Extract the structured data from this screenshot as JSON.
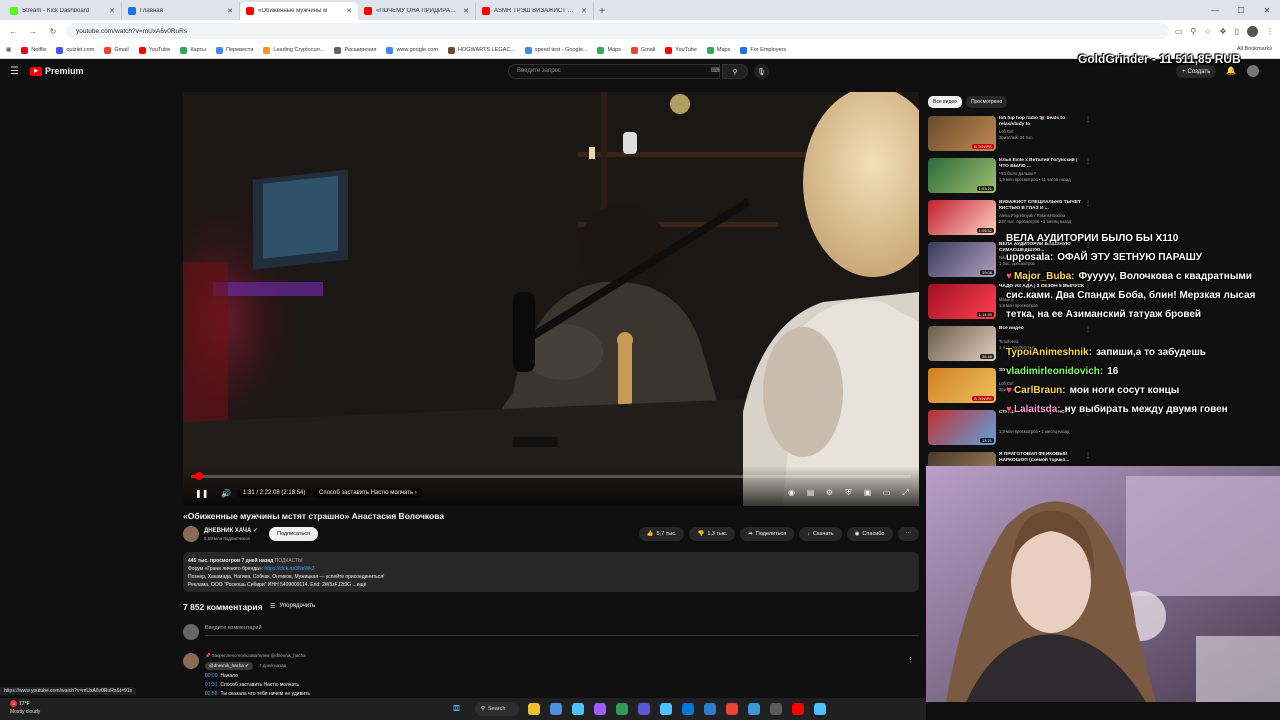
{
  "browser": {
    "tabs": [
      {
        "label": "Stream - Kick Dashboard",
        "color": "#53fc18",
        "active": false
      },
      {
        "label": "Главная",
        "color": "#1a73e8",
        "active": false
      },
      {
        "label": "«Обиженные мужчины м",
        "color": "#ff0000",
        "active": true
      },
      {
        "label": "«ПОЧЕМУ ОНА ПРИДИРАЕТС",
        "color": "#ff0000",
        "active": false
      },
      {
        "label": "ASMR ТРЭШ ВИЗАЖИСТ ДЕЛ",
        "color": "#ff0000",
        "active": false
      }
    ],
    "url": "youtube.com/watch?v=mUxA6v0RuRs",
    "bookmarks": [
      {
        "label": "Netflix",
        "color": "#e50914"
      },
      {
        "label": "quizlet.com",
        "color": "#4255ff"
      },
      {
        "label": "Gmail",
        "color": "#ea4335"
      },
      {
        "label": "YouTube",
        "color": "#ff0000"
      },
      {
        "label": "Карты",
        "color": "#34a853"
      },
      {
        "label": "Перевести",
        "color": "#4285f4"
      },
      {
        "label": "Leading Cryptocurr...",
        "color": "#f7931a"
      },
      {
        "label": "Расширения",
        "color": "#5f6368"
      },
      {
        "label": "www.google.com",
        "color": "#4285f4"
      },
      {
        "label": "HOGWARTS LEGAC...",
        "color": "#6b4a2b"
      },
      {
        "label": "speed test - Google...",
        "color": "#4285f4"
      },
      {
        "label": "Maps",
        "color": "#34a853"
      },
      {
        "label": "Gmail",
        "color": "#ea4335"
      },
      {
        "label": "YouTube",
        "color": "#ff0000"
      },
      {
        "label": "Maps",
        "color": "#34a853"
      },
      {
        "label": "For Employers",
        "color": "#1a73e8"
      }
    ],
    "all_bookmarks": "All Bookmarks",
    "status_link": "https://www.youtube.com/watch?v=mUxA6v0RuRs&t=91s"
  },
  "youtube": {
    "logo": "Premium",
    "search_placeholder": "Введите запрос",
    "create_label": "Создать",
    "player": {
      "time": "1:31 / 2:22:08 (2:18:54)",
      "chapter": "Способ заставить Настю молчать",
      "progress": 0.011
    },
    "video": {
      "title": "«Обиженные мужчины мстят страшно» Анастасия Волочкова",
      "channel": "ДНЕВНИК ХАЧА",
      "subscribers": "5,69 млн подписчиков",
      "subscribe": "Подписаться",
      "likes": "5,7 тыс.",
      "dislikes": "1,3 тыс.",
      "share": "Поделиться",
      "download": "Скачать",
      "thanks": "Спасибо"
    },
    "description": {
      "meta": "445 тыс. просмотров  7 дней назад",
      "tag": "ПОДКАСТЫ",
      "line1_pre": "Форум «Грани личного бренда»: ",
      "line1_link": "https://clck.ru/3NeWk3",
      "line2": "Познер, Хакамада, Нагиев, Собчак, Онтиков, Мужицкая — успейте присоединиться!",
      "line3": "Реклама. ООО \"Роскошь Сибири\" ИНН 5409009114. Erid: 2W5zFJ2t9G ...ещё"
    },
    "comments": {
      "count": "7 852 комментария",
      "sort": "Упорядочить",
      "input_placeholder": "Введите комментарий",
      "pinned_label": "Закреплено пользователем @dnevnik_hacha",
      "pinned_author": "@dnevnik_hacha",
      "pinned_date": "7 дней назад",
      "lines": [
        {
          "ts": "00:00",
          "text": "Начало"
        },
        {
          "ts": "01:31",
          "text": "Способ заставить Настю молчать"
        },
        {
          "ts": "02:58",
          "text": "Ты сказала что тебя ничем не удивить"
        }
      ]
    },
    "chips": [
      "Все видео",
      "Просмотрено"
    ],
    "recommendations": [
      {
        "title": "lofi hip hop radio 📚 beats to relax/study to",
        "channel": "Lofi Girl",
        "meta": "Зрителей: 24 тыс.",
        "badge": "В ЭФИРЕ",
        "colors": [
          "#6a4a2a",
          "#c08a55"
        ]
      },
      {
        "title": "Илья Exile x Виталий Гогунский | ЧТО БЫЛО ...",
        "channel": "Что было дальше?",
        "meta": "1,9 млн просмотров • 11 часов назад",
        "badge": "1:53:21",
        "colors": [
          "#2a6a3a",
          "#a0c070"
        ]
      },
      {
        "title": "ВИЗАЖИСТ СПЕЦИАЛЬНО ТЫЧЕТ КИСТЬЮ В ГЛАЗ И ...",
        "channel": "Alena Pogrebnyak / RobinsHoodina",
        "meta": "237 тыс. просмотров • 1 месяц назад",
        "badge": "1:05:52",
        "colors": [
          "#c02030",
          "#ffd0c0"
        ]
      },
      {
        "title": "ВЕЛА АУДИТОРИИ БЕШЕНУЮ СУМАСШЕДШУЮ...",
        "channel": "Nikita",
        "meta": "1 тыс. просмотров",
        "badge": "19:08",
        "colors": [
          "#3a3a5a",
          "#b0a0c0"
        ]
      },
      {
        "title": "ЧАДО ИЗ АДА | 3 СЕЗОН 5 ВЫПУСК",
        "channel": "Мама в",
        "meta": "1,9 млн просмотров",
        "badge": "1:14:50",
        "colors": [
          "#a01020",
          "#ff4050"
        ]
      },
      {
        "title": "Все видео",
        "channel": "Timofeeva",
        "meta": "1 тыс. просмотров",
        "badge": "36:48",
        "colors": [
          "#6a5a4a",
          "#e0d0c0"
        ]
      },
      {
        "title": "Stream",
        "channel": "Lofi Girl",
        "meta": "Зрителей",
        "badge": "В ЭФИРЕ",
        "colors": [
          "#d08020",
          "#f0c060"
        ]
      },
      {
        "title": "СТРАШНЫХ АТТРАКЦИОНО...",
        "channel": "",
        "meta": "1,5 млн просмотров • 1 месяц назад",
        "badge": "13:21",
        "colors": [
          "#c03030",
          "#60a0e0"
        ]
      },
      {
        "title": "Я ПРИГОТОВИЛ ФЕЙКОВЫЙ НАРКОШОП (схемой торчко...",
        "channel": "",
        "meta": "",
        "badge": "",
        "colors": [
          "#4a3a2a",
          "#a08060"
        ]
      }
    ]
  },
  "overlay": {
    "balance": "GoldGrinder - 11 511,85 RUB",
    "chat": [
      {
        "user": "",
        "text": "ВЕЛА АУДИТОРИИ БЫЛО БЫ Х110",
        "user_color": "#ffffff",
        "badge": false
      },
      {
        "user": "upposala:",
        "text": "ОФАЙ ЭТУ ЗЕТНУЮ ПАРАШУ",
        "user_color": "#ffffff",
        "badge": false
      },
      {
        "user": "Major_Buba:",
        "text": "Фууууу, Волочкова с квадратными сис.ками. Два Спандж Боба, блин! Мерзкая лысая тетка, на ее Азиманский татуаж бровей",
        "user_color": "#ffd84a",
        "badge": true
      },
      {
        "user": "TypoiAnimeshnik:",
        "text": "запиши,а то забудешь",
        "user_color": "#ffd84a",
        "badge": false
      },
      {
        "user": "vladimirleonidovich:",
        "text": "16",
        "user_color": "#7dff6a",
        "badge": false
      },
      {
        "user": "CarlBraun:",
        "text": "мои ноги сосут концы",
        "user_color": "#ffd84a",
        "badge": true
      },
      {
        "user": "Lalaitsda:",
        "text": "ну выбирать между двумя говен",
        "user_color": "#ff9ad5",
        "badge": true
      }
    ]
  },
  "taskbar": {
    "weather_temp": "77°F",
    "weather_desc": "Mostly cloudy",
    "notif_count": "3",
    "search": "Search",
    "apps": [
      "#f0c030",
      "#4a90e2",
      "#4cc2ff",
      "#a05aff",
      "#2d9a5a",
      "#5a5ad0",
      "#4cc2ff",
      "#0078d4",
      "#2d7dd2",
      "#ea4335",
      "#3a9ad9",
      "#5a5a5a",
      "#ff0000",
      "#4cc2ff"
    ]
  }
}
